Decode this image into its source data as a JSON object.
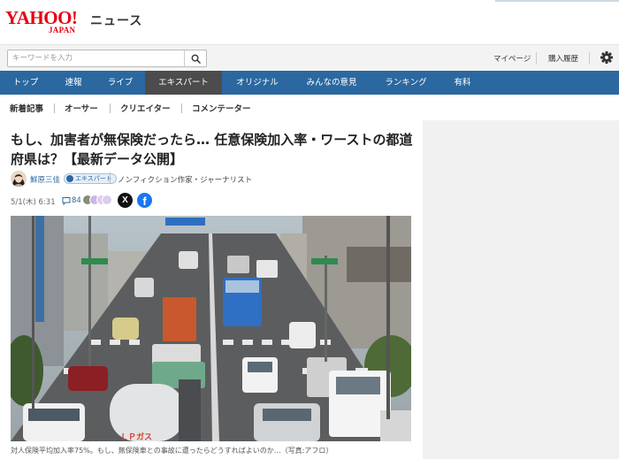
{
  "header": {
    "logo_text": "YAHOO!",
    "logo_sub": "JAPAN",
    "section_name": "ニュース"
  },
  "search": {
    "placeholder": "キーワードを入力",
    "value": "",
    "icon": "search-icon"
  },
  "utility": {
    "mypage_label": "マイページ",
    "history_label": "購入履歴",
    "settings_icon": "gear-icon"
  },
  "nav": {
    "active_index": 3,
    "items": [
      {
        "label": "トップ"
      },
      {
        "label": "速報"
      },
      {
        "label": "ライブ"
      },
      {
        "label": "エキスパート"
      },
      {
        "label": "オリジナル"
      },
      {
        "label": "みんなの意見"
      },
      {
        "label": "ランキング"
      },
      {
        "label": "有料"
      }
    ]
  },
  "subnav": {
    "items": [
      {
        "label": "新着記事"
      },
      {
        "label": "オーサー"
      },
      {
        "label": "クリエイター"
      },
      {
        "label": "コメンテーター"
      }
    ]
  },
  "article": {
    "title": "もし、加害者が無保険だったら… 任意保険加入率・ワーストの都道府県は？【最新データ公開】",
    "author": {
      "name": "鮮原三佳",
      "badge": "エキスパート",
      "title": "ノンフィクション作家・ジャーナリスト"
    },
    "date": "5/1(木) 6:31",
    "comment_count": "84",
    "share": {
      "x_label": "X",
      "facebook_label": "f"
    },
    "photo_text": "ＬＰガス",
    "caption": "対人保険平均加入率75%。もし、無保険車との事故に遭ったらどうすればよいのか…（写真:アフロ）"
  },
  "colors": {
    "brand_red": "#e60012",
    "nav_blue": "#2b68a0",
    "nav_active": "#4c4c4c"
  }
}
